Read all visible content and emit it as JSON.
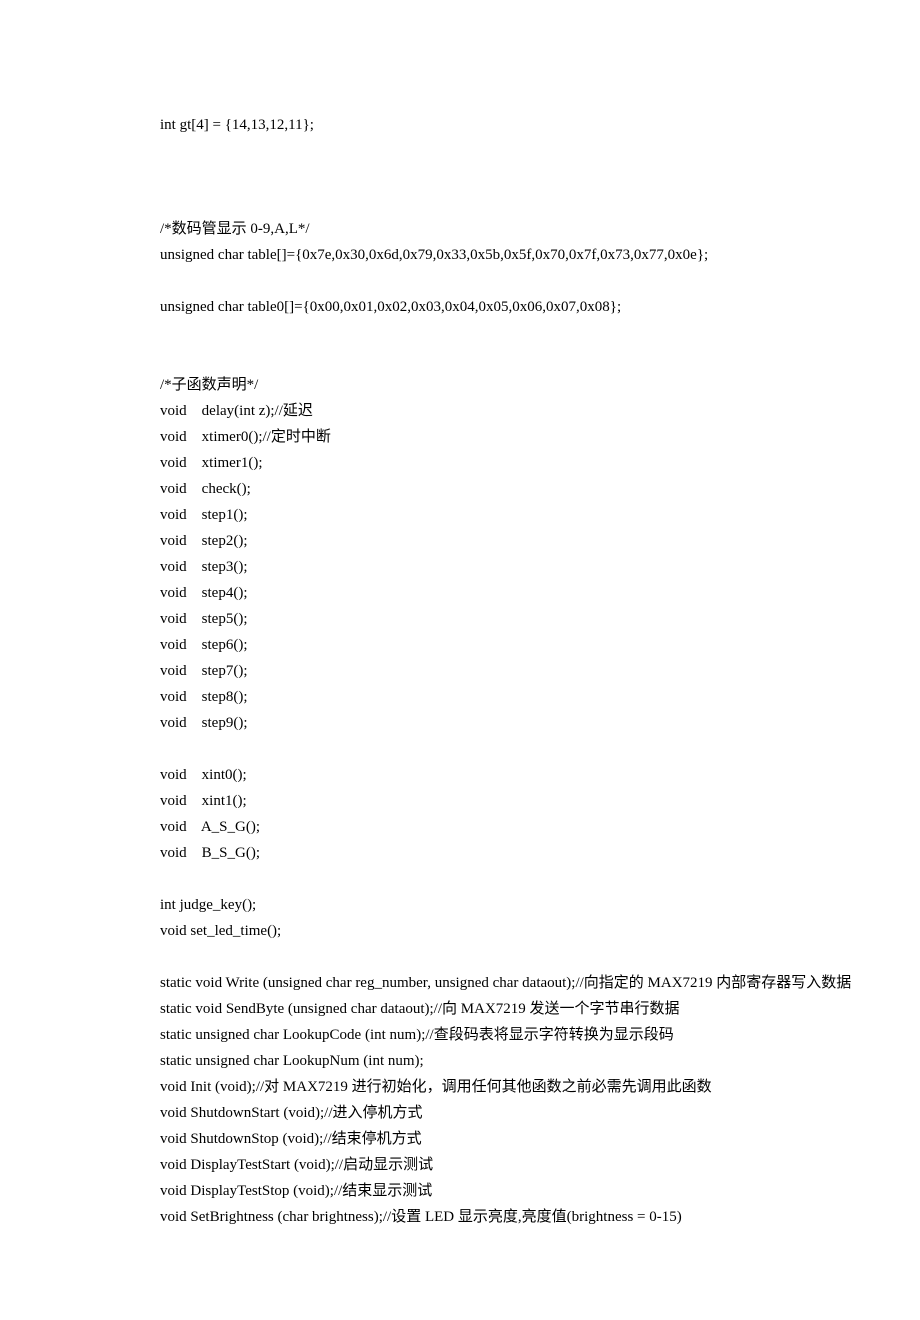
{
  "lines": [
    "int gt[4] = {14,13,12,11};",
    "",
    "",
    "",
    "/*数码管显示 0-9,A,L*/",
    "unsigned char table[]={0x7e,0x30,0x6d,0x79,0x33,0x5b,0x5f,0x70,0x7f,0x73,0x77,0x0e};",
    "",
    "unsigned char table0[]={0x00,0x01,0x02,0x03,0x04,0x05,0x06,0x07,0x08};",
    "",
    "",
    "/*子函数声明*/",
    "void    delay(int z);//延迟",
    "void    xtimer0();//定时中断",
    "void    xtimer1();",
    "void    check();",
    "void    step1();",
    "void    step2();",
    "void    step3();",
    "void    step4();",
    "void    step5();",
    "void    step6();",
    "void    step7();",
    "void    step8();",
    "void    step9();",
    "",
    "void    xint0();",
    "void    xint1();",
    "void    A_S_G();",
    "void    B_S_G();",
    "",
    "int judge_key();",
    "void set_led_time();",
    "",
    "static void Write (unsigned char reg_number, unsigned char dataout);//向指定的 MAX7219 内部寄存器写入数据",
    "static void SendByte (unsigned char dataout);//向 MAX7219 发送一个字节串行数据",
    "static unsigned char LookupCode (int num);//查段码表将显示字符转换为显示段码",
    "static unsigned char LookupNum (int num);",
    "void Init (void);//对 MAX7219 进行初始化，调用任何其他函数之前必需先调用此函数",
    "void ShutdownStart (void);//进入停机方式",
    "void ShutdownStop (void);//结束停机方式",
    "void DisplayTestStart (void);//启动显示测试",
    "void DisplayTestStop (void);//结束显示测试",
    "void SetBrightness (char brightness);//设置 LED 显示亮度,亮度值(brightness = 0-15)"
  ]
}
